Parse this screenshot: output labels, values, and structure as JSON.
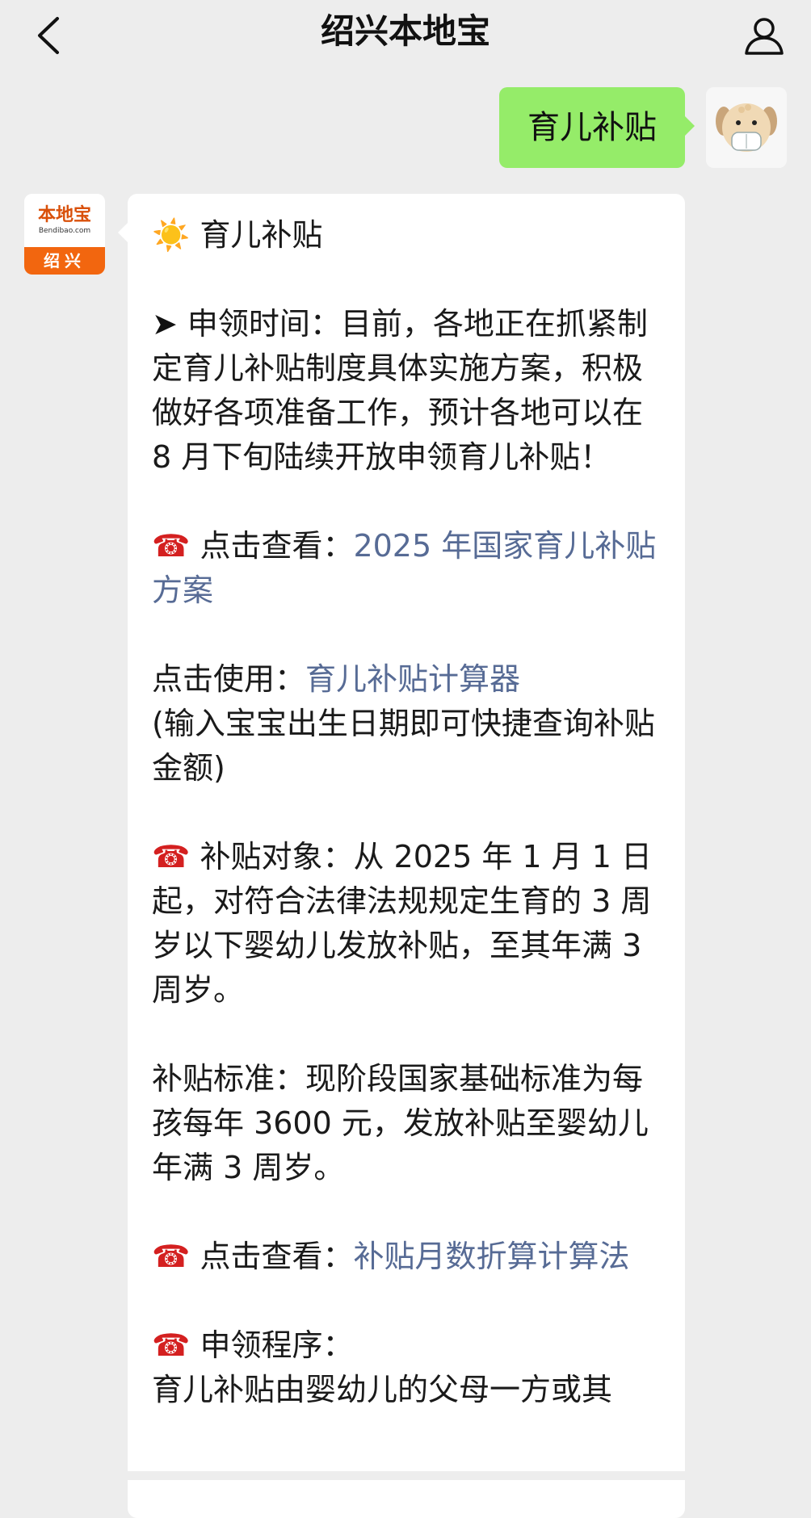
{
  "header": {
    "title": "绍兴本地宝",
    "back_icon": "chevron-left-icon",
    "profile_icon": "person-icon"
  },
  "user_message": {
    "text": "育儿补贴",
    "bubble_color": "#95ec69"
  },
  "bot_avatar": {
    "logo_main": "本地宝",
    "logo_sub": "Bendibao.com",
    "logo_city": "绍兴",
    "accent_color": "#f2660f"
  },
  "bot_message": {
    "heading_icon": "☀️",
    "heading": "育儿补贴",
    "apply_time_prefix": "➤ ",
    "apply_time": "申领时间：目前，各地正在抓紧制定育儿补贴制度具体实施方案，积极做好各项准备工作，预计各地可以在 8 月下旬陆续开放申领育儿补贴！",
    "phone_icon": "☎",
    "view1_label": "点击查看：",
    "view1_link": "2025 年国家育儿补贴方案",
    "use_label": "点击使用：",
    "use_link": "育儿补贴计算器",
    "use_note": "(输入宝宝出生日期即可快捷查询补贴金额)",
    "target_label": "补贴对象：",
    "target_text": "从 2025 年 1 月 1 日起，对符合法律法规规定生育的 3 周岁以下婴幼儿发放补贴，至其年满 3 周岁。",
    "standard_text": "补贴标准：现阶段国家基础标准为每孩每年 3600 元，发放补贴至婴幼儿年满 3 周岁。",
    "view2_label": "点击查看：",
    "view2_link": "补贴月数折算计算法",
    "procedure_label": "申领程序：",
    "procedure_text": "育儿补贴由婴幼儿的父母一方或其",
    "link_color": "#576b95"
  }
}
